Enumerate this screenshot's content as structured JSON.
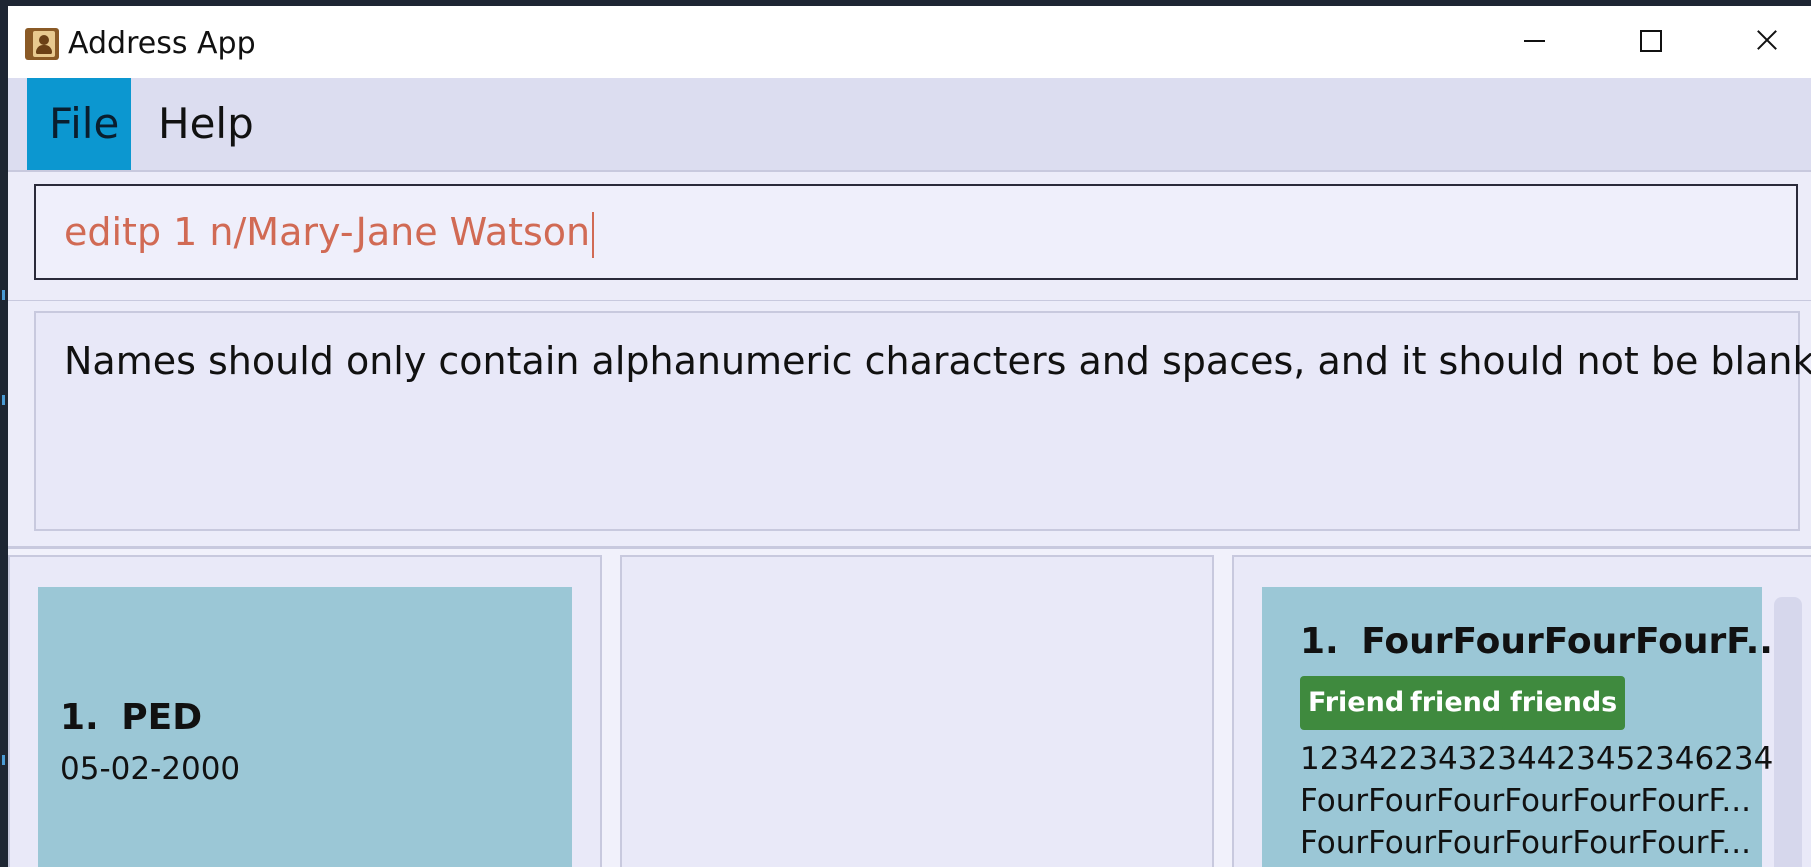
{
  "window": {
    "title": "Address App"
  },
  "menu": {
    "file_label": "File",
    "help_label": "Help"
  },
  "command": {
    "value": "editp 1 n/Mary-Jane Watson"
  },
  "result": {
    "message": "Names should only contain alphanumeric characters and spaces, and it should not be blank"
  },
  "left_panel": {
    "card": {
      "index": "1.",
      "name": "PED",
      "date": "05-02-2000"
    }
  },
  "right_panel": {
    "card": {
      "index": "1.",
      "name": "FourFourFourFourF...",
      "tags": [
        "Friend",
        "friend",
        "friends"
      ],
      "phone": "123422343234423452346234",
      "line2": "FourFourFourFourFourFourF...",
      "line3": "FourFourFourFourFourFourF..."
    }
  },
  "colors": {
    "accent": "#0c97d0",
    "card": "#9bc7d6",
    "tag": "#3f8a3e",
    "command_text": "#d16a54"
  }
}
